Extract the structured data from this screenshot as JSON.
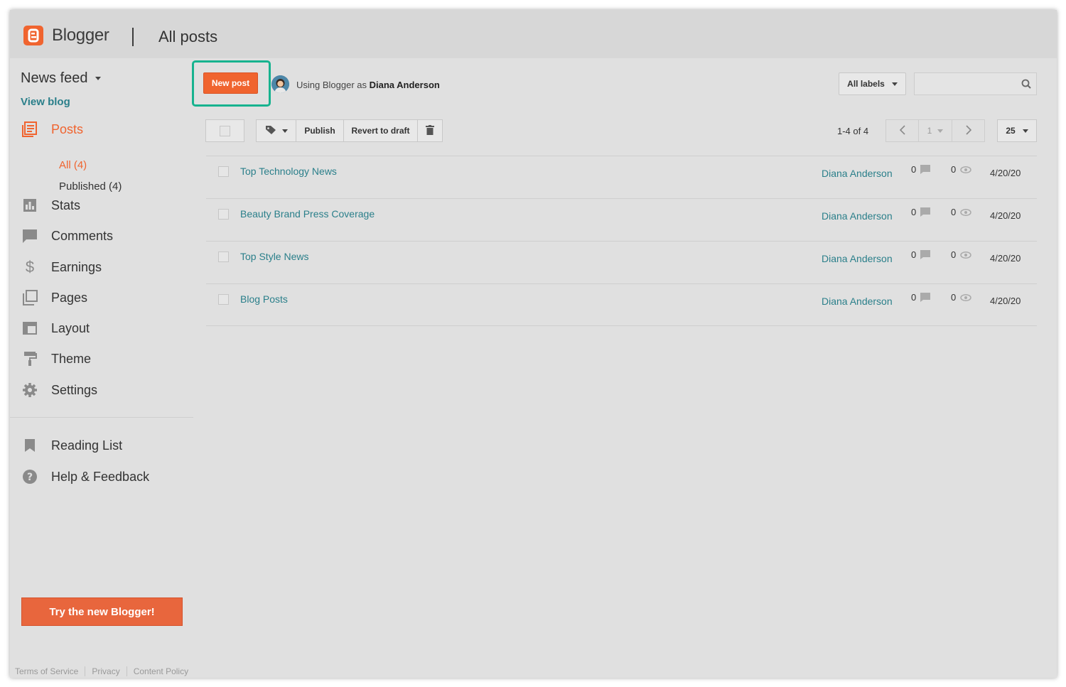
{
  "header": {
    "brand": "Blogger",
    "page_title": "All posts"
  },
  "sidebar": {
    "blog_name": "News feed",
    "view_blog": "View blog",
    "items": [
      {
        "label": "Posts",
        "icon": "posts-icon",
        "active": true
      },
      {
        "label": "Stats",
        "icon": "stats-icon"
      },
      {
        "label": "Comments",
        "icon": "comments-icon"
      },
      {
        "label": "Earnings",
        "icon": "dollar-icon"
      },
      {
        "label": "Pages",
        "icon": "pages-icon"
      },
      {
        "label": "Layout",
        "icon": "layout-icon"
      },
      {
        "label": "Theme",
        "icon": "paint-roller-icon"
      },
      {
        "label": "Settings",
        "icon": "gear-icon"
      }
    ],
    "post_filters": [
      {
        "label": "All (4)",
        "active": true
      },
      {
        "label": "Published (4)"
      }
    ],
    "secondary": [
      {
        "label": "Reading List",
        "icon": "bookmark-icon"
      },
      {
        "label": "Help & Feedback",
        "icon": "help-icon"
      }
    ],
    "try_new": "Try the new Blogger!",
    "footer": [
      "Terms of Service",
      "Privacy",
      "Content Policy"
    ]
  },
  "toolbar": {
    "new_post": "New post",
    "using_prefix": "Using Blogger as",
    "user_name": "Diana Anderson",
    "labels_filter": "All labels",
    "search_placeholder": "",
    "publish": "Publish",
    "revert": "Revert to draft",
    "count": "1-4 of 4",
    "page": "1",
    "per_page": "25"
  },
  "posts": [
    {
      "title": "Top Technology News",
      "author": "Diana Anderson",
      "comments": "0",
      "views": "0",
      "date": "4/20/20"
    },
    {
      "title": "Beauty Brand Press Coverage",
      "author": "Diana Anderson",
      "comments": "0",
      "views": "0",
      "date": "4/20/20"
    },
    {
      "title": "Top Style News",
      "author": "Diana Anderson",
      "comments": "0",
      "views": "0",
      "date": "4/20/20"
    },
    {
      "title": "Blog Posts",
      "author": "Diana Anderson",
      "comments": "0",
      "views": "0",
      "date": "4/20/20"
    }
  ],
  "colors": {
    "accent": "#f0642f",
    "link": "#2a7f8a",
    "highlight": "#17b38f"
  }
}
